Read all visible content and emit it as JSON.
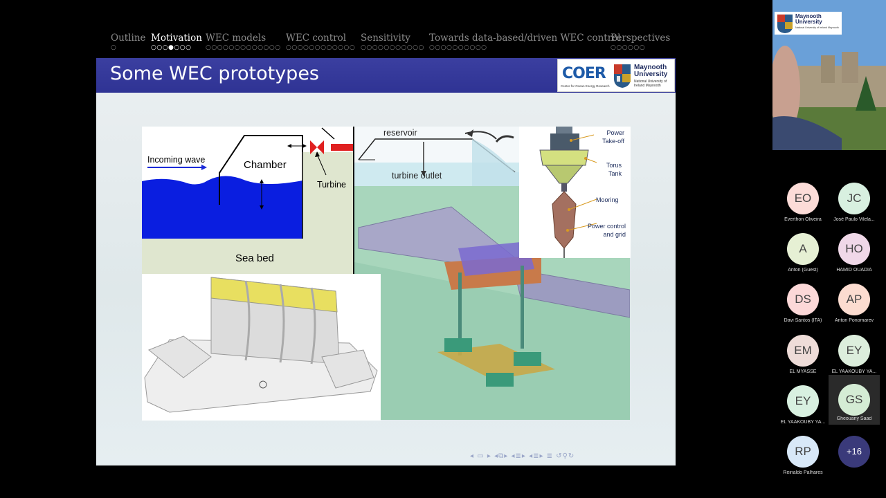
{
  "slide": {
    "nav_sections": [
      {
        "label": "Outline",
        "dots": "○",
        "active": false
      },
      {
        "label": "Motivation",
        "dots": "○○○●○○○",
        "active": true
      },
      {
        "label": "WEC models",
        "dots": "○○○○○○○○○○○○○",
        "active": false
      },
      {
        "label": "WEC control",
        "dots": "○○○○○○○○○○○○",
        "active": false
      },
      {
        "label": "Sensitivity",
        "dots": "○○○○○○○○○○○",
        "active": false
      },
      {
        "label": "Towards data-based/driven WEC control",
        "dots": "○○○○○○○○○○",
        "active": false
      },
      {
        "label": "Perspectives",
        "dots": "○○○○○○",
        "active": false
      }
    ],
    "title": "Some WEC prototypes",
    "logos": {
      "coer": "COER",
      "coer_sub": "Center for Ocean Energy Research",
      "maynooth": "Maynooth University",
      "maynooth_sub": "National University of Ireland Maynooth"
    },
    "owc_diagram": {
      "incoming_wave": "Incoming wave",
      "chamber": "Chamber",
      "turbine": "Turbine",
      "sea_bed": "Sea bed"
    },
    "overtopping_diagram": {
      "reservoir": "reservoir",
      "turbine_outlet": "turbine outlet"
    },
    "buoy_diagram": {
      "power_takeoff": "Power Take-off",
      "torus_tank": "Torus Tank",
      "mooring": "Mooring",
      "power_control": "Power control and grid"
    },
    "beamer_nav_icons": [
      "triangle-left-icon",
      "frame-icon",
      "triangle-right-icon",
      "subsection-icon",
      "section-icon",
      "align-icon",
      "search-icon"
    ]
  },
  "webcam": {
    "logo_name": "Maynooth University",
    "logo_sub": "National University of Ireland Maynooth"
  },
  "participants": [
    {
      "initials": "EO",
      "name": "Everthon Oliveira",
      "color": "#fcdcd8"
    },
    {
      "initials": "JC",
      "name": "José Paulo Vilela...",
      "color": "#d8f0e0"
    },
    {
      "initials": "A",
      "name": "Anton (Guest)",
      "color": "#e6f0d4"
    },
    {
      "initials": "HO",
      "name": "HAMID OUADIA",
      "color": "#f0d8e8"
    },
    {
      "initials": "DS",
      "name": "Davi Santos (ITA)",
      "color": "#fcd8d8"
    },
    {
      "initials": "AP",
      "name": "Anton Ponomarev",
      "color": "#fcdcd0"
    },
    {
      "initials": "EM",
      "name": "EL MYASSE",
      "color": "#eedcd8"
    },
    {
      "initials": "EY",
      "name": "EL YAAKOUBY YA...",
      "color": "#dceedc"
    },
    {
      "initials": "EY",
      "name": "EL YAAKOUBY YA...",
      "color": "#d8f0e0"
    },
    {
      "initials": "GS",
      "name": "Gheouany Saad",
      "color": "#d4ecd4"
    },
    {
      "initials": "RP",
      "name": "Reinaldo Palhares",
      "color": "#d8e8f8"
    }
  ],
  "more_participants": "+16"
}
